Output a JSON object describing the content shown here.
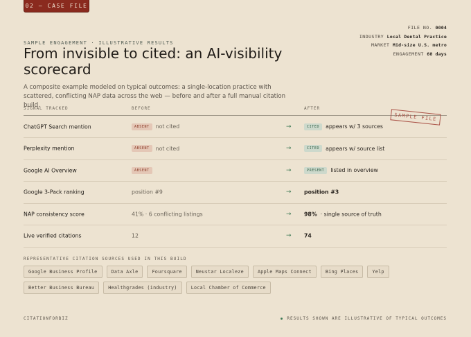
{
  "case_badge": "02 — CASE FILE",
  "meta": [
    {
      "label": "FILE NO.",
      "value": "0004"
    },
    {
      "label": "INDUSTRY",
      "value": "Local Dental Practice"
    },
    {
      "label": "MARKET",
      "value": "Mid-size U.S. metro"
    },
    {
      "label": "ENGAGEMENT",
      "value": "60 days"
    }
  ],
  "eyebrow": "SAMPLE ENGAGEMENT · ILLUSTRATIVE RESULTS",
  "title": "From invisible to cited: an AI-visibility scorecard",
  "description": "A composite example modeled on typical outcomes: a single-location practice with scattered, conflicting NAP data across the web — before and after a full manual citation build.",
  "table": {
    "headers": {
      "signal": "SIGNAL TRACKED",
      "before": "BEFORE",
      "after": "AFTER"
    },
    "arrow": "→",
    "rows": [
      {
        "signal": "ChatGPT Search mention",
        "before_badge": "ABSENT",
        "before_text": "not cited",
        "after_badge": "CITED",
        "after_bold": "",
        "after_text": "appears w/ 3 sources"
      },
      {
        "signal": "Perplexity mention",
        "before_badge": "ABSENT",
        "before_text": "not cited",
        "after_badge": "CITED",
        "after_bold": "",
        "after_text": "appears w/ source list"
      },
      {
        "signal": "Google AI Overview",
        "before_badge": "ABSENT",
        "before_text": "",
        "after_badge": "PRESENT",
        "after_bold": "",
        "after_text": "listed in overview"
      },
      {
        "signal": "Google 3-Pack ranking",
        "before_badge": "",
        "before_text": "position #9",
        "after_badge": "",
        "after_bold": "position #3",
        "after_text": ""
      },
      {
        "signal": "NAP consistency score",
        "before_badge": "",
        "before_text": "41% · 6 conflicting listings",
        "after_badge": "",
        "after_bold": "98%",
        "after_text": "· single source of truth"
      },
      {
        "signal": "Live verified citations",
        "before_badge": "",
        "before_text": "12",
        "after_badge": "",
        "after_bold": "74",
        "after_text": ""
      }
    ]
  },
  "stamp": "SAMPLE FILE",
  "sources": {
    "label": "REPRESENTATIVE CITATION SOURCES USED IN THIS BUILD",
    "items": [
      "Google Business Profile",
      "Data Axle",
      "Foursquare",
      "Neustar Localeze",
      "Apple Maps Connect",
      "Bing Places",
      "Yelp",
      "Better Business Bureau",
      "Healthgrades (industry)",
      "Local Chamber of Commerce"
    ]
  },
  "footer": {
    "brand": "CITATIONFORBIZ",
    "note": "RESULTS SHOWN ARE ILLUSTRATIVE OF TYPICAL OUTCOMES"
  },
  "colors": {
    "background": "#ede3d1",
    "accent_red": "#8a2a1e",
    "accent_green": "#3e7a55"
  }
}
